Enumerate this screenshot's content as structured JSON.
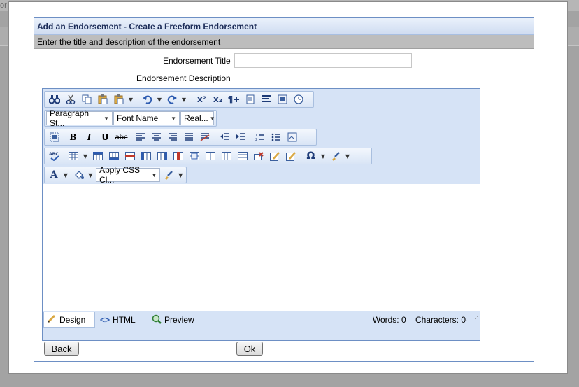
{
  "background": {
    "corner_text": "or"
  },
  "panel": {
    "title": "Add an Endorsement - Create a Freeform Endorsement",
    "subtitle": "Enter the title and description of the endorsement"
  },
  "form": {
    "title_label": "Endorsement Title",
    "title_value": "",
    "description_label": "Endorsement Description"
  },
  "editor": {
    "toolbar": {
      "paragraph_style": "Paragraph St...",
      "font_name": "Font Name",
      "font_size": "Real...",
      "css_class": "Apply CSS Cl...",
      "bold": "B",
      "italic": "I",
      "underline": "U",
      "strike": "abc",
      "superscript": "x²",
      "subscript": "x₂",
      "paragraph_mark": "¶+",
      "omega": "Ω",
      "font_color": "A"
    },
    "modes": {
      "design": "Design",
      "html": "HTML",
      "preview": "Preview"
    },
    "status": {
      "words": "Words: 0",
      "characters": "Characters: 0"
    }
  },
  "buttons": {
    "back": "Back",
    "ok": "Ok"
  },
  "colors": {
    "accent": "#6d8fc4",
    "toolbar_bg": "#d6e3f6",
    "title_text": "#1c2c58"
  }
}
